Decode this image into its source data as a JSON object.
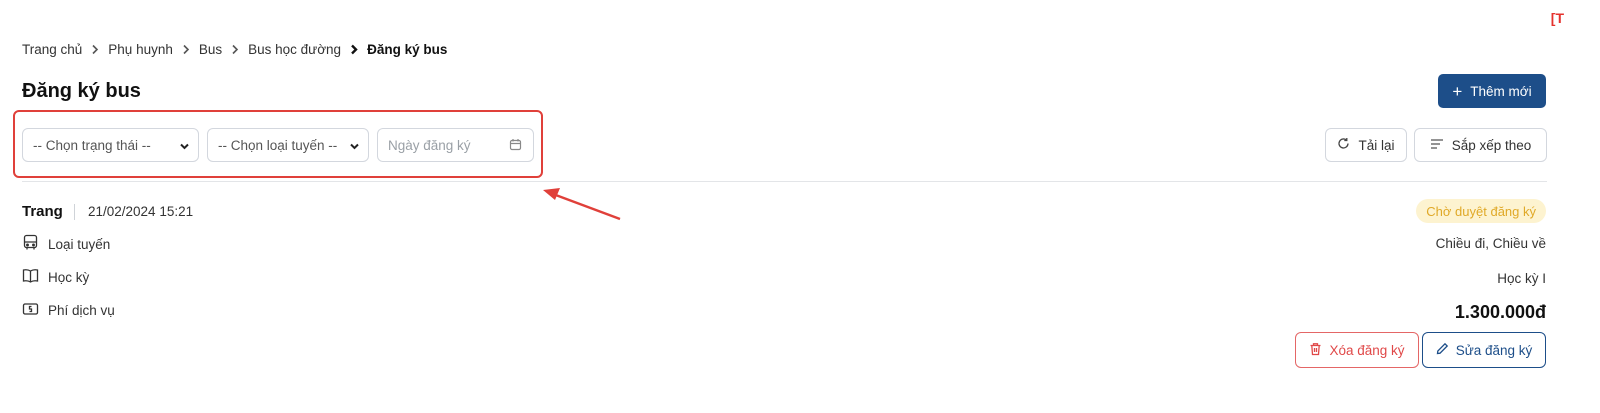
{
  "corner_tag": "[T",
  "breadcrumb": {
    "items": [
      "Trang chủ",
      "Phụ huynh",
      "Bus",
      "Bus học đường"
    ],
    "current": "Đăng ký bus"
  },
  "page_title": "Đăng ký bus",
  "toolbar": {
    "add_label": "Thêm mới",
    "status_select": "-- Chọn trạng thái --",
    "route_select": "-- Chọn loại tuyến --",
    "date_placeholder": "Ngày đăng ký",
    "reload_label": "Tải lại",
    "sort_label": "Sắp xếp theo"
  },
  "record": {
    "name": "Trang",
    "date": "21/02/2024 15:21",
    "status": "Chờ duyệt đăng ký",
    "fields": {
      "route_label": "Loại tuyến",
      "route_value": "Chiều đi, Chiều về",
      "semester_label": "Học kỳ",
      "semester_value": "Học kỳ I",
      "fee_label": "Phí dịch vụ",
      "fee_value": "1.300.000đ"
    },
    "actions": {
      "delete_label": "Xóa đăng ký",
      "edit_label": "Sửa đăng ký"
    }
  },
  "colors": {
    "primary": "#1d4e89",
    "highlight": "#e0403a",
    "badge_bg": "#fdf3d0",
    "badge_text": "#e0a928",
    "danger": "#e04848"
  },
  "icons": [
    "chevron-right-icon",
    "plus-icon",
    "chevron-down-icon",
    "calendar-icon",
    "refresh-icon",
    "sort-lines-icon",
    "bus-icon",
    "book-icon",
    "money-icon",
    "trash-icon",
    "pencil-icon"
  ]
}
